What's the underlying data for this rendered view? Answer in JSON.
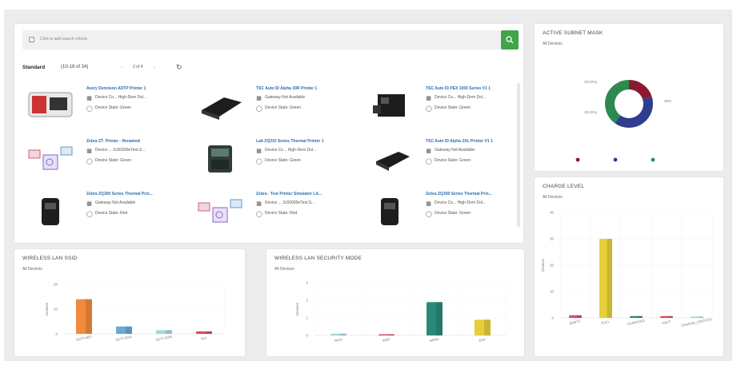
{
  "search": {
    "placeholder": "Click to add search criteria"
  },
  "toolbar": {
    "view": "Standard",
    "range": "(10-18 of 34)",
    "prev": "←",
    "page": "2 of 4",
    "next": "→"
  },
  "devices": [
    {
      "name": "Avery Dennison ADTP Printer 1",
      "line1": "Device Co...   High-Dem Dol...",
      "line2": "Device State: Green",
      "icon1": "device-icon",
      "icon2": "status-icon"
    },
    {
      "name": "TSC Auto ID Alpha 30R Printer 1",
      "line1": "Gateway Not Available",
      "line2": "Device State: Green",
      "icon1": "gateway-icon",
      "icon2": "status-icon"
    },
    {
      "name": "TSC Auto ID PEX 1000 Series V1 1",
      "line1": "Device Co...   High-Dem Dol...",
      "line2": "Device State: Green",
      "icon1": "device-icon",
      "icon2": "status-icon"
    },
    {
      "name": "Zebra ZT- Printer - Renamed",
      "line1": "Device ...   2c50000eTest.S...",
      "line2": "Device State: Green",
      "icon1": "device-icon",
      "icon2": "status-icon"
    },
    {
      "name": "Lab ZQ310 Series Thermal Printer 1",
      "line1": "Device Co...   High-Dem Dol...",
      "line2": "Device State: Green",
      "icon1": "device-icon",
      "icon2": "status-icon"
    },
    {
      "name": "TSC Auto ID Alpha 2XL Printer V1 1",
      "line1": "Gateway Not Available",
      "line2": "Device State: Green",
      "icon1": "gateway-icon",
      "icon2": "status-icon"
    },
    {
      "name": "Zebra ZQ300 Series Thermal Prin...",
      "line1": "Gateway Not Available",
      "line2": "Device State: Red",
      "icon1": "gateway-icon",
      "icon2": "status-icon"
    },
    {
      "name": "Zebra - Test Printer Simulator LA...",
      "line1": "Device ...   2c50000eTest.S...",
      "line2": "Device State: Red",
      "icon1": "device-icon",
      "icon2": "status-icon"
    },
    {
      "name": "Zebra ZQ300 Series Thermal Prin...",
      "line1": "Device Co...   High-Dem Dol...",
      "line2": "Device State: Green",
      "icon1": "device-icon",
      "icon2": "status-icon"
    }
  ],
  "subnet": {
    "title": "ACTIVE SUBNET MASK",
    "subtitle": "All Devices",
    "chart_data": {
      "type": "pie",
      "slices": [
        {
          "label": "20%",
          "value": 20,
          "color": "#8b1a2e"
        },
        {
          "label": "40%",
          "value": 40,
          "color": "#2f3c8f"
        },
        {
          "label": "40%",
          "value": 40,
          "color": "#2d8a4e"
        }
      ],
      "slice_labels": [
        "(20.0%)",
        "(20.0%)",
        "20%"
      ]
    }
  },
  "charge": {
    "title": "CHARGE LEVEL",
    "subtitle": "All Devices",
    "chart_data": {
      "type": "bar",
      "ylabel": "Devices",
      "yticks": [
        "40",
        "30",
        "20",
        "10",
        "0"
      ],
      "ylim": [
        0,
        40
      ],
      "categories": [
        "EMPTY",
        "FULL",
        "CHARGING",
        "HALF",
        "CHARGE_CRITICAL"
      ],
      "values": [
        1,
        30,
        0.7,
        0.7,
        0.5
      ],
      "colors": [
        "#e04a5a",
        "#e6cf3a",
        "#2a8a7a",
        "#e04a5a",
        "#a9d6e0"
      ]
    }
  },
  "ssid": {
    "title": "WIRELESS LAN SSID",
    "subtitle": "All Devices",
    "chart_data": {
      "type": "bar",
      "ylabel": "Devices",
      "yticks": [
        "20",
        "10",
        "0"
      ],
      "ylim": [
        0,
        20
      ],
      "categories": [
        "SSTT-WiFi",
        "SSTT-QXA",
        "SSTT-QXB",
        "N/A"
      ],
      "values": [
        14,
        3,
        1.5,
        1
      ],
      "colors": [
        "#f28a3c",
        "#6aa8d8",
        "#a9d6e0",
        "#e04a5a"
      ]
    }
  },
  "security": {
    "title": "WIRELESS LAN SECURITY MODE",
    "subtitle": "All Devices",
    "chart_data": {
      "type": "bar",
      "ylabel": "Devices",
      "yticks": [
        "3",
        "2",
        "1",
        "0"
      ],
      "ylim": [
        0,
        3
      ],
      "categories": [
        "None",
        "WEP",
        "WPA2",
        "EAP"
      ],
      "values": [
        0.1,
        0.05,
        1.9,
        0.9
      ],
      "colors": [
        "#a9d6e0",
        "#e04a5a",
        "#2a8a7a",
        "#e6cf3a"
      ]
    }
  }
}
